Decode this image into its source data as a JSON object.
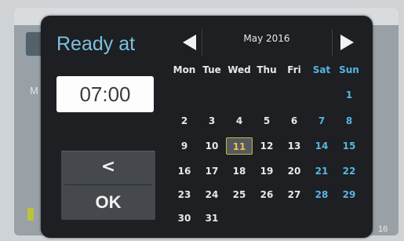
{
  "dialog": {
    "title": "Ready at",
    "time_value": "07:00",
    "back_label": "<",
    "ok_label": "OK"
  },
  "calendar": {
    "month_label": "May 2016",
    "weekdays": [
      "Mon",
      "Tue",
      "Wed",
      "Thu",
      "Fri",
      "Sat",
      "Sun"
    ],
    "weeks": [
      [
        "",
        "",
        "",
        "",
        "",
        "",
        "1"
      ],
      [
        "2",
        "3",
        "4",
        "5",
        "6",
        "7",
        "8"
      ],
      [
        "9",
        "10",
        "11",
        "12",
        "13",
        "14",
        "15"
      ],
      [
        "16",
        "17",
        "18",
        "19",
        "20",
        "21",
        "22"
      ],
      [
        "23",
        "24",
        "25",
        "26",
        "27",
        "28",
        "29"
      ],
      [
        "30",
        "31",
        "",
        "",
        "",
        "",
        ""
      ]
    ],
    "selected_day": "11"
  },
  "background": {
    "left_letter": "M",
    "right_text": "16"
  },
  "colors": {
    "accent": "#7ac1df",
    "weekend": "#58b4e3",
    "weekday_text": "#e8e8e8",
    "selected_day_text": "#e6c54a",
    "selected_border": "#c8b43c"
  },
  "icons": {
    "prev_month": "triangle-left-icon",
    "next_month": "triangle-right-icon"
  }
}
